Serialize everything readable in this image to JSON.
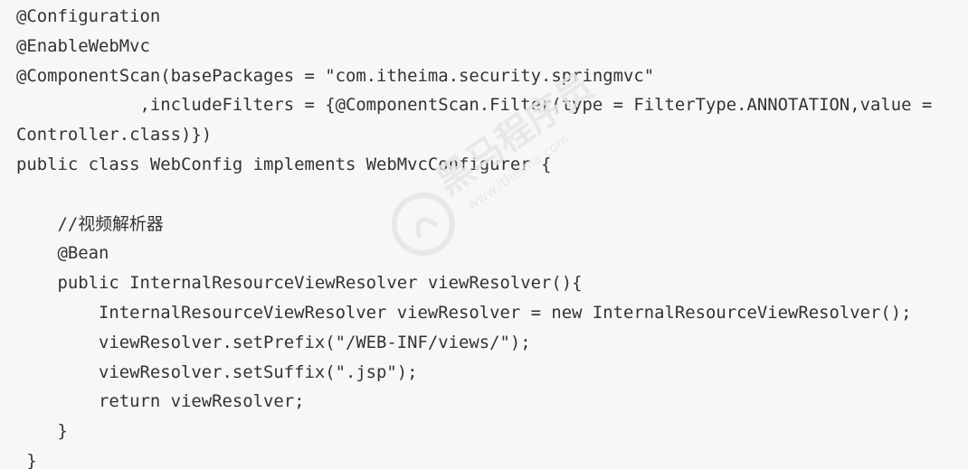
{
  "code": {
    "lines": [
      "@Configuration",
      "@EnableWebMvc",
      "@ComponentScan(basePackages = \"com.itheima.security.springmvc\"",
      "            ,includeFilters = {@ComponentScan.Filter(type = FilterType.ANNOTATION,value =",
      "Controller.class)})",
      "public class WebConfig implements WebMvcConfigurer {",
      "",
      "    //视频解析器",
      "    @Bean",
      "    public InternalResourceViewResolver viewResolver(){",
      "        InternalResourceViewResolver viewResolver = new InternalResourceViewResolver();",
      "        viewResolver.setPrefix(\"/WEB-INF/views/\");",
      "        viewResolver.setSuffix(\".jsp\");",
      "        return viewResolver;",
      "    }",
      " }"
    ]
  },
  "watermark": {
    "text_cn": "黑马程序员",
    "text_url": "www.itheima.com",
    "color": "#e6e6e6"
  }
}
